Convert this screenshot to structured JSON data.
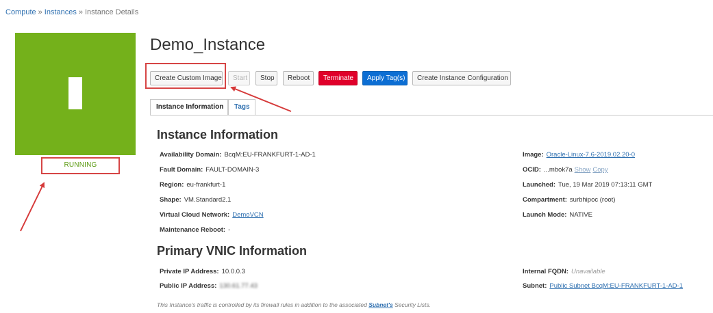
{
  "breadcrumb": {
    "compute": "Compute",
    "instances": "Instances",
    "current": "Instance Details",
    "separator": "»"
  },
  "instance": {
    "title": "Demo_Instance",
    "state": "RUNNING",
    "tile_color": "#74b11b",
    "state_color": "#5a9a10"
  },
  "actions": {
    "create_custom_image": "Create Custom Image",
    "start": "Start",
    "stop": "Stop",
    "reboot": "Reboot",
    "terminate": "Terminate",
    "apply_tags": "Apply Tag(s)",
    "create_instance_configuration": "Create Instance Configuration"
  },
  "tabs": [
    {
      "label": "Instance Information",
      "active": true
    },
    {
      "label": "Tags",
      "active": false
    }
  ],
  "instance_info": {
    "heading": "Instance Information",
    "availability_domain": {
      "label": "Availability Domain:",
      "value": "BcqM:EU-FRANKFURT-1-AD-1"
    },
    "fault_domain": {
      "label": "Fault Domain:",
      "value": "FAULT-DOMAIN-3"
    },
    "region": {
      "label": "Region:",
      "value": "eu-frankfurt-1"
    },
    "shape": {
      "label": "Shape:",
      "value": "VM.Standard2.1"
    },
    "vcn": {
      "label": "Virtual Cloud Network:",
      "value": "DemoVCN"
    },
    "maintenance_reboot": {
      "label": "Maintenance Reboot:",
      "value": "-"
    },
    "image": {
      "label": "Image:",
      "value": "Oracle-Linux-7.6-2019.02.20-0"
    },
    "ocid": {
      "label": "OCID:",
      "value": "...mbok7a",
      "show": "Show",
      "copy": "Copy"
    },
    "launched": {
      "label": "Launched:",
      "value": "Tue, 19 Mar 2019 07:13:11 GMT"
    },
    "compartment": {
      "label": "Compartment:",
      "value": "surbhipoc (root)"
    },
    "launch_mode": {
      "label": "Launch Mode:",
      "value": "NATIVE"
    }
  },
  "vnic_info": {
    "heading": "Primary VNIC Information",
    "private_ip": {
      "label": "Private IP Address:",
      "value": "10.0.0.3"
    },
    "public_ip": {
      "label": "Public IP Address:",
      "value": "130.61.77.43"
    },
    "internal_fqdn": {
      "label": "Internal FQDN:",
      "value": "Unavailable"
    },
    "subnet": {
      "label": "Subnet:",
      "value": "Public Subnet BcqM:EU-FRANKFURT-1-AD-1"
    }
  },
  "footer": {
    "before": "This Instance's traffic is controlled by its firewall rules in addition to the associated ",
    "link": "Subnet's",
    "after": " Security Lists."
  }
}
